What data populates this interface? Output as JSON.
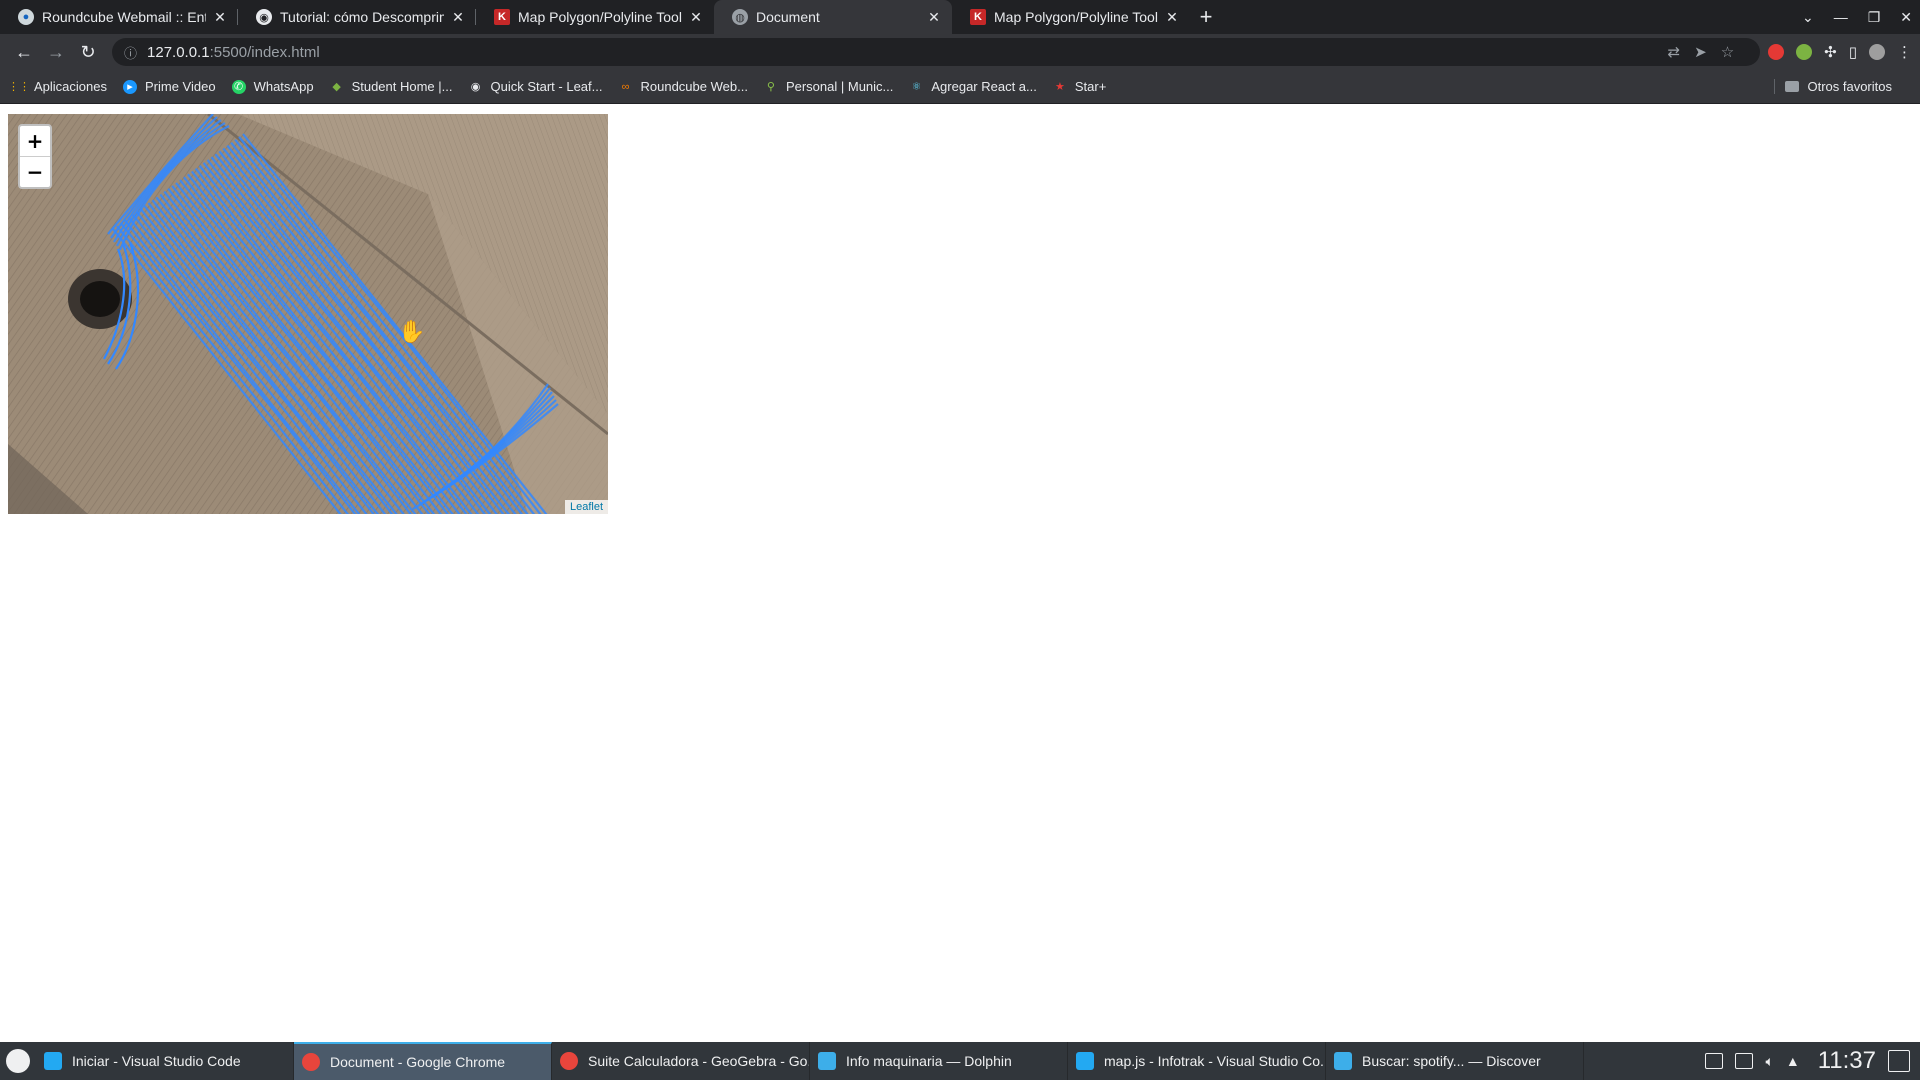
{
  "tabs": [
    {
      "title": "Roundcube Webmail :: Entrad",
      "icon": "roundcube-icon",
      "active": false
    },
    {
      "title": "Tutorial: cómo Descomprimir",
      "icon": "github-icon",
      "active": false
    },
    {
      "title": "Map Polygon/Polyline Tool",
      "icon": "k-icon",
      "active": false
    },
    {
      "title": "Document",
      "icon": "globe-icon",
      "active": true
    },
    {
      "title": "Map Polygon/Polyline Tool",
      "icon": "k-icon",
      "active": false
    }
  ],
  "address": {
    "host": "127.0.0.1",
    "path": ":5500/index.html"
  },
  "bookmarks": [
    {
      "label": "Aplicaciones",
      "icon": "apps-grid-icon",
      "color": "#f4b400"
    },
    {
      "label": "Prime Video",
      "icon": "prime-video-icon",
      "color": "#1a98ff"
    },
    {
      "label": "WhatsApp",
      "icon": "whatsapp-icon",
      "color": "#25d366"
    },
    {
      "label": "Student Home |...",
      "icon": "student-home-icon",
      "color": "#7cb342"
    },
    {
      "label": "Quick Start - Leaf...",
      "icon": "github-icon",
      "color": "#e8eaed"
    },
    {
      "label": "Roundcube Web...",
      "icon": "roundcube-icon",
      "color": "#f57c00"
    },
    {
      "label": "Personal | Munic...",
      "icon": "map-pin-icon",
      "color": "#8bc34a"
    },
    {
      "label": "Agregar React a...",
      "icon": "react-icon",
      "color": "#61dafb"
    },
    {
      "label": "Star+",
      "icon": "star-icon",
      "color": "#e53935"
    }
  ],
  "bookmarks_other": "Otros favoritos",
  "map": {
    "zoom_in": "+",
    "zoom_out": "−",
    "attribution": "Leaflet",
    "polyline_color": "#3388ff"
  },
  "taskbar": [
    {
      "label": "Iniciar - Visual Studio Code",
      "icon": "vscode-icon",
      "color": "#23a9f2",
      "active": false
    },
    {
      "label": "Document - Google Chrome",
      "icon": "chrome-icon",
      "color": "#e8453c",
      "active": true
    },
    {
      "label": "Suite Calculadora - GeoGebra - Go...",
      "icon": "chrome-icon",
      "color": "#e8453c",
      "active": false
    },
    {
      "label": "Info maquinaria — Dolphin",
      "icon": "folder-icon",
      "color": "#3daee9",
      "active": false
    },
    {
      "label": "map.js - Infotrak - Visual Studio Co...",
      "icon": "vscode-icon",
      "color": "#23a9f2",
      "active": false
    },
    {
      "label": "Buscar: spotify... — Discover",
      "icon": "discover-icon",
      "color": "#3daee9",
      "active": false
    }
  ],
  "clock": "11:37"
}
